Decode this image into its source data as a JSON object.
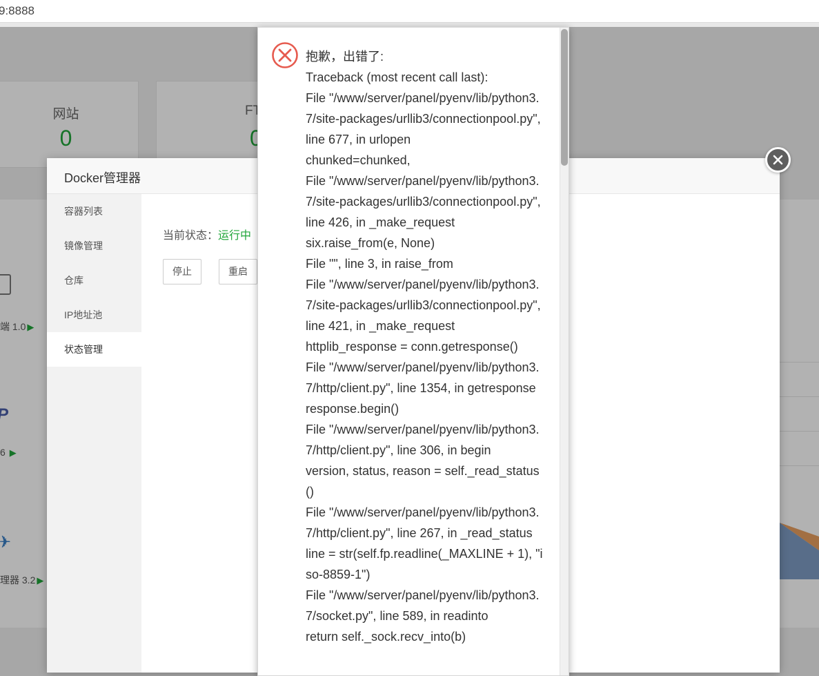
{
  "browser": {
    "url": "9:8888"
  },
  "dashboard": {
    "cards": [
      {
        "label": "网站",
        "count": "0"
      },
      {
        "label": "FT",
        "count": "0"
      }
    ],
    "software": [
      {
        "name": "端 1.0"
      },
      {
        "name": "6"
      },
      {
        "name": "理器 3.2"
      }
    ],
    "php_logo": "P"
  },
  "docker_modal": {
    "title": "Docker管理器",
    "sidebar": [
      {
        "label": "容器列表"
      },
      {
        "label": "镜像管理"
      },
      {
        "label": "仓库"
      },
      {
        "label": "IP地址池"
      },
      {
        "label": "状态管理"
      }
    ],
    "active_tab": 4,
    "status_label": "当前状态：",
    "status_value": "运行中",
    "buttons": {
      "stop": "停止",
      "restart": "重启"
    }
  },
  "error_dialog": {
    "lines": [
      "抱歉，出错了:",
      "Traceback (most recent call last):",
      "File \"/www/server/panel/pyenv/lib/python3.7/site-packages/urllib3/connectionpool.py\", line 677, in urlopen",
      "chunked=chunked,",
      "File \"/www/server/panel/pyenv/lib/python3.7/site-packages/urllib3/connectionpool.py\", line 426, in _make_request",
      "six.raise_from(e, None)",
      "File \"\", line 3, in raise_from",
      "File \"/www/server/panel/pyenv/lib/python3.7/site-packages/urllib3/connectionpool.py\", line 421, in _make_request",
      "httplib_response = conn.getresponse()",
      "File \"/www/server/panel/pyenv/lib/python3.7/http/client.py\", line 1354, in getresponse",
      "response.begin()",
      "File \"/www/server/panel/pyenv/lib/python3.7/http/client.py\", line 306, in begin",
      "version, status, reason = self._read_status()",
      "File \"/www/server/panel/pyenv/lib/python3.7/http/client.py\", line 267, in _read_status",
      "line = str(self.fp.readline(_MAXLINE + 1), \"iso-8859-1\")",
      "File \"/www/server/panel/pyenv/lib/python3.7/socket.py\", line 589, in readinto",
      "return self._sock.recv_into(b)"
    ]
  },
  "colors": {
    "accent": "#20a53a",
    "error": "#e65a4e",
    "close": "#5e5e5e"
  }
}
